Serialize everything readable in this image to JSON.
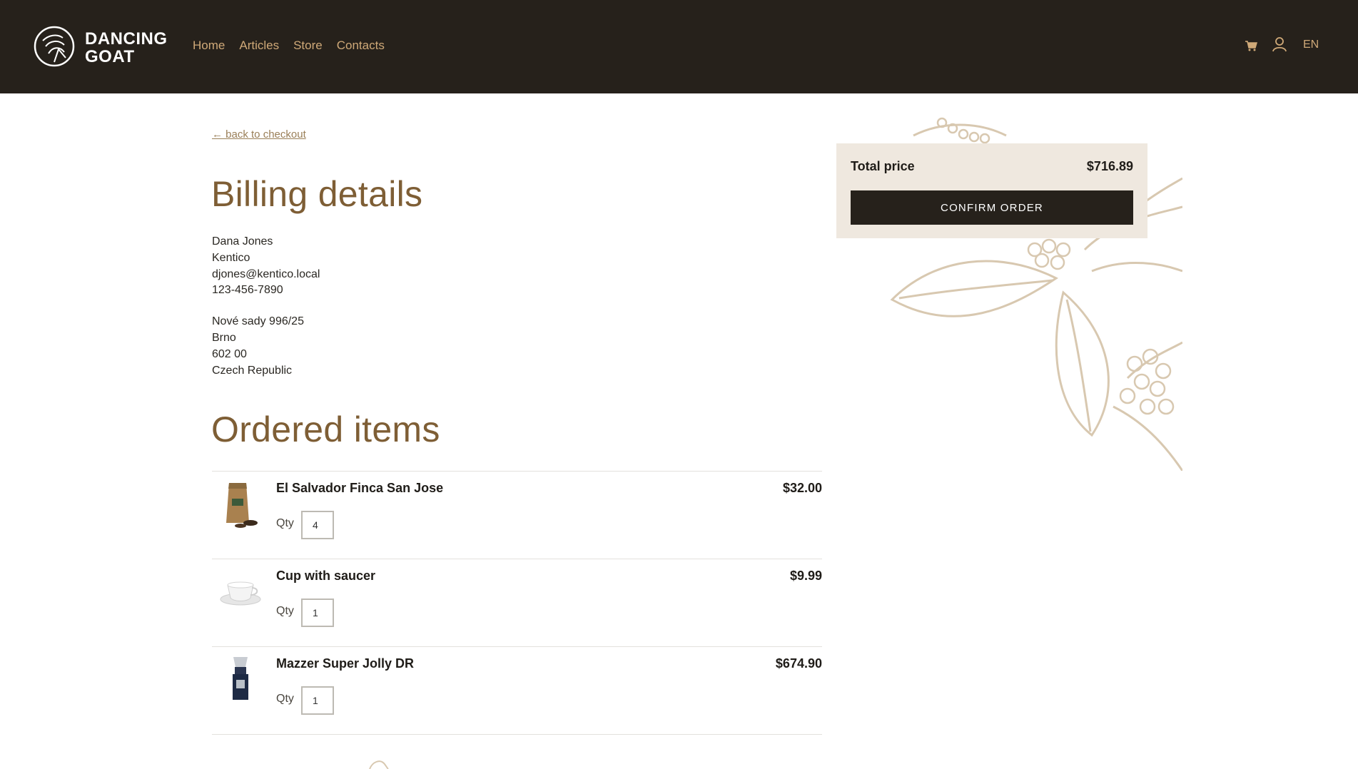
{
  "header": {
    "brand_line1": "DANCING",
    "brand_line2": "GOAT",
    "nav": [
      "Home",
      "Articles",
      "Store",
      "Contacts"
    ],
    "lang": "EN",
    "icons": [
      "cart-icon",
      "user-icon"
    ]
  },
  "back_link": "← back to checkout",
  "billing": {
    "title": "Billing details",
    "name": "Dana Jones",
    "company": "Kentico",
    "email": "djones@kentico.local",
    "phone": "123-456-7890",
    "street": "Nové sady 996/25",
    "city": "Brno",
    "zip": "602 00",
    "country": "Czech Republic"
  },
  "ordered": {
    "title": "Ordered items",
    "qty_label": "Qty",
    "items": [
      {
        "name": "El Salvador Finca San Jose",
        "price": "$32.00",
        "qty": "4"
      },
      {
        "name": "Cup with saucer",
        "price": "$9.99",
        "qty": "1"
      },
      {
        "name": "Mazzer Super Jolly DR",
        "price": "$674.90",
        "qty": "1"
      }
    ]
  },
  "summary": {
    "total_label": "Total price",
    "total_value": "$716.89",
    "confirm_label": "CONFIRM ORDER"
  },
  "colors": {
    "header_bg": "#26211b",
    "accent": "#7e5e35",
    "nav": "#cfa978",
    "panel_bg": "#efe8df"
  }
}
